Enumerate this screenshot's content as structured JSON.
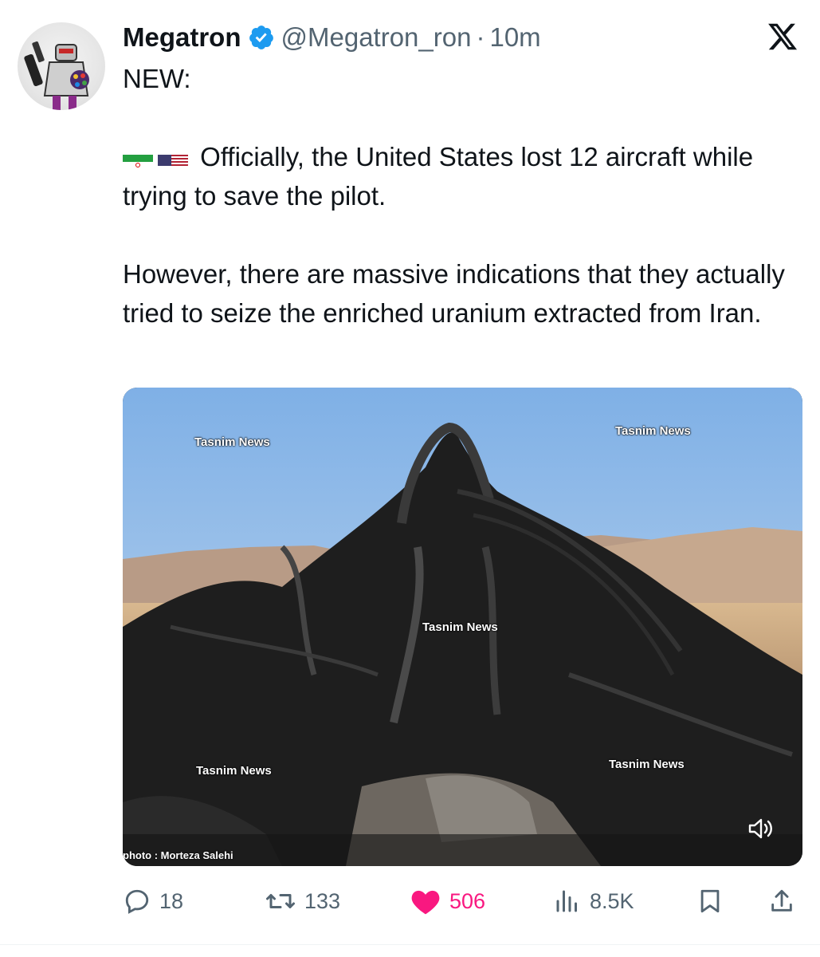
{
  "author": {
    "name": "Megatron",
    "handle": "@Megatron_ron",
    "separator": "·",
    "time": "10m",
    "verified": true
  },
  "post": {
    "line1": "NEW:",
    "flags": [
      "iran-flag-icon",
      "us-flag-icon"
    ],
    "paragraph1": "Officially, the United States lost 12 aircraft while trying to save the pilot.",
    "paragraph2": "However, there are massive indications that they actually tried to seize the enriched uranium extracted from Iran."
  },
  "media": {
    "watermarks": [
      "Tasnim News",
      "Tasnim News",
      "Tasnim News",
      "Tasnim News",
      "Tasnim News"
    ],
    "credit": "photo : Morteza Salehi"
  },
  "metrics": {
    "replies": "18",
    "reposts": "133",
    "likes": "506",
    "views": "8.5K"
  },
  "colors": {
    "verified": "#1d9bf0",
    "like": "#f91880",
    "muted": "#536471"
  }
}
